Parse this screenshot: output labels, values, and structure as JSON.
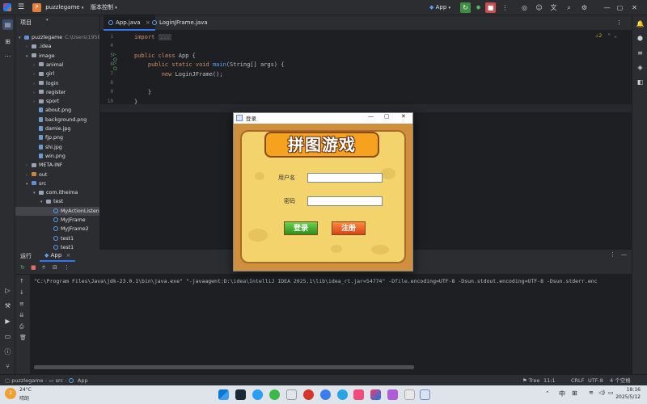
{
  "titlebar": {
    "project_initial": "P",
    "project_name": "puzzlegame",
    "vcs_label": "版本控制",
    "run_config": "App"
  },
  "project_panel": {
    "title": "项目",
    "tree": [
      {
        "label": "puzzlegame",
        "hint": "C:\\Users\\1958",
        "depth": 0,
        "expanded": true,
        "type": "folder-blue"
      },
      {
        "label": ".idea",
        "depth": 1,
        "expanded": false,
        "type": "folder"
      },
      {
        "label": "image",
        "depth": 1,
        "expanded": true,
        "type": "folder"
      },
      {
        "label": "animal",
        "depth": 2,
        "expanded": false,
        "type": "folder"
      },
      {
        "label": "girl",
        "depth": 2,
        "expanded": false,
        "type": "folder"
      },
      {
        "label": "login",
        "depth": 2,
        "expanded": false,
        "type": "folder"
      },
      {
        "label": "register",
        "depth": 2,
        "expanded": false,
        "type": "folder"
      },
      {
        "label": "sport",
        "depth": 2,
        "expanded": false,
        "type": "folder"
      },
      {
        "label": "about.png",
        "depth": 2,
        "type": "image"
      },
      {
        "label": "background.png",
        "depth": 2,
        "type": "image"
      },
      {
        "label": "damie.jpg",
        "depth": 2,
        "type": "image"
      },
      {
        "label": "fjp.png",
        "depth": 2,
        "type": "image"
      },
      {
        "label": "shi.jpg",
        "depth": 2,
        "type": "image"
      },
      {
        "label": "win.png",
        "depth": 2,
        "type": "image"
      },
      {
        "label": "META-INF",
        "depth": 1,
        "expanded": false,
        "type": "folder"
      },
      {
        "label": "out",
        "depth": 1,
        "expanded": false,
        "type": "folder-orange"
      },
      {
        "label": "src",
        "depth": 1,
        "expanded": true,
        "type": "folder-blue"
      },
      {
        "label": "com.itheima",
        "depth": 2,
        "expanded": true,
        "type": "folder"
      },
      {
        "label": "test",
        "depth": 3,
        "expanded": true,
        "type": "folder"
      },
      {
        "label": "MyActionListen",
        "depth": 4,
        "type": "java",
        "selected": true
      },
      {
        "label": "MyJFrame",
        "depth": 4,
        "type": "java"
      },
      {
        "label": "MyJFrame2",
        "depth": 4,
        "type": "java"
      },
      {
        "label": "test1",
        "depth": 4,
        "type": "java"
      },
      {
        "label": "test1",
        "depth": 4,
        "type": "java"
      }
    ]
  },
  "tabs": [
    {
      "label": "App.java",
      "active": true
    },
    {
      "label": "LoginJFrame.java",
      "active": false
    }
  ],
  "editor": {
    "warnings": "2",
    "lines": [
      {
        "n": "1",
        "tokens": [
          {
            "t": "import ",
            "c": "kw"
          },
          {
            "t": "...",
            "c": "fold"
          }
        ]
      },
      {
        "n": "4",
        "tokens": []
      },
      {
        "n": "5",
        "tokens": [
          {
            "t": "public class ",
            "c": "kw"
          },
          {
            "t": "App {",
            "c": ""
          }
        ]
      },
      {
        "n": "6",
        "tokens": [
          {
            "t": "    public static void ",
            "c": "kw"
          },
          {
            "t": "main",
            "c": "fn"
          },
          {
            "t": "(String[] args) {",
            "c": ""
          }
        ]
      },
      {
        "n": "7",
        "tokens": [
          {
            "t": "        new ",
            "c": "kw"
          },
          {
            "t": "LoginJFrame();",
            "c": ""
          }
        ]
      },
      {
        "n": "8",
        "tokens": []
      },
      {
        "n": "9",
        "tokens": [
          {
            "t": "    }",
            "c": ""
          }
        ]
      },
      {
        "n": "10",
        "tokens": [
          {
            "t": "}",
            "c": ""
          }
        ]
      },
      {
        "n": "11",
        "tokens": []
      }
    ]
  },
  "run_panel": {
    "title": "运行",
    "tab": "App",
    "console_line": "\"C:\\Program Files\\Java\\jdk-23.0.1\\bin\\java.exe\" \"-javaagent:D:\\idea\\IntelliJ IDEA 2025.1\\lib\\idea_rt.jar=54774\" -Dfile.encoding=UTF-8 -Dsun.stdout.encoding=UTF-8 -Dsun.stderr.enc"
  },
  "statusbar": {
    "crumbs": [
      "puzzlegame",
      "src",
      "App"
    ],
    "tree_label": "Tree",
    "position": "11:1",
    "line_sep": "CRLF",
    "encoding": "UTF-8",
    "indent": "4 个空格"
  },
  "taskbar": {
    "weather_temp": "24°C",
    "weather_desc": "晴朗",
    "lang": "中",
    "time": "18:16",
    "date": "2025/5/12"
  },
  "dialog": {
    "title": "登录",
    "game_title": "拼图游戏",
    "username_label": "用户名",
    "password_label": "密码",
    "username_value": "",
    "password_value": "",
    "login_button": "登录",
    "register_button": "注册",
    "colors": {
      "login": "#3aa02c",
      "register": "#e3541a",
      "wood": "#cf8f3c",
      "cheese": "#f3d36c"
    }
  }
}
